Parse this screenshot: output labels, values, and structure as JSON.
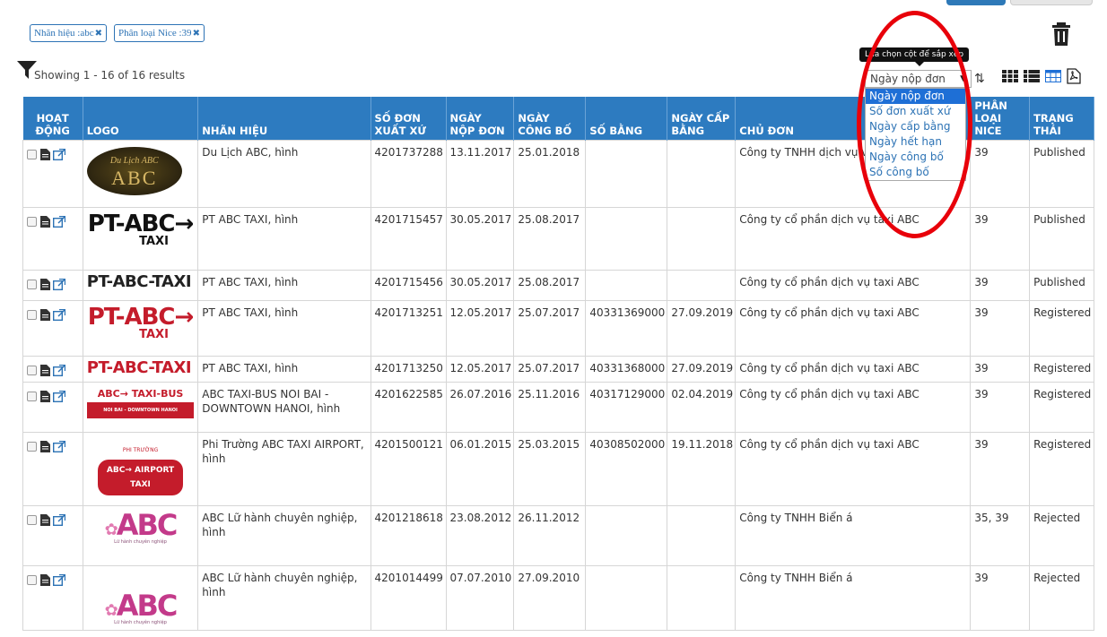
{
  "filters": {
    "tags": [
      {
        "label": "Nhãn hiệu :abc"
      },
      {
        "label": "Phân loại Nice :39"
      }
    ],
    "remove_glyph": "✖"
  },
  "results_text": "Showing 1 - 16 of 16 results",
  "sort": {
    "tooltip": "Lựa chọn cột để sắp xếp",
    "selected": "Ngày nộp đơn",
    "options": [
      "Ngày nộp đơn",
      "Số đơn xuất xứ",
      "Ngày cấp bằng",
      "Ngày hết hạn",
      "Ngày công bố",
      "Số công bố"
    ]
  },
  "icons": {
    "trash": "trash-icon",
    "filter": "filter-icon",
    "grid": "grid-view-icon",
    "list": "list-view-icon",
    "table": "table-view-icon",
    "pdf": "pdf-icon",
    "sort_direction": "sort-direction-icon"
  },
  "table": {
    "headers": {
      "action": "HOẠT ĐỘNG",
      "logo": "LOGO",
      "mark": "NHÃN HIỆU",
      "app_no": "SỐ ĐƠN XUẤT XỨ",
      "filing_date": "NGÀY NỘP ĐƠN",
      "pub_date": "NGÀY CÔNG BỐ",
      "reg_no": "SỐ BẰNG",
      "grant_date": "NGÀY CẤP BẰNG",
      "owner": "CHỦ ĐƠN",
      "nice": "PHÂN LOẠI NICE",
      "status": "TRẠNG THÁI"
    },
    "rows": [
      {
        "logo_text": "Du Lịch ABC",
        "mark": "Du Lịch ABC, hình",
        "app_no": "4201737288",
        "filing_date": "13.11.2017",
        "pub_date": "25.01.2018",
        "reg_no": "",
        "grant_date": "",
        "owner": "Công ty TNHH dịch vụ và",
        "nice": "39",
        "status": "Published"
      },
      {
        "logo_text": "PT ABC TAXI",
        "mark": "PT ABC TAXI, hình",
        "app_no": "4201715457",
        "filing_date": "30.05.2017",
        "pub_date": "25.08.2017",
        "reg_no": "",
        "grant_date": "",
        "owner": "Công ty cổ phần dịch vụ taxi ABC",
        "nice": "39",
        "status": "Published"
      },
      {
        "logo_text": "PT ABC TAXI",
        "mark": "PT ABC TAXI, hình",
        "app_no": "4201715456",
        "filing_date": "30.05.2017",
        "pub_date": "25.08.2017",
        "reg_no": "",
        "grant_date": "",
        "owner": "Công ty cổ phần dịch vụ taxi ABC",
        "nice": "39",
        "status": "Published"
      },
      {
        "logo_text": "PT ABC TAXI",
        "mark": "PT ABC TAXI, hình",
        "app_no": "4201713251",
        "filing_date": "12.05.2017",
        "pub_date": "25.07.2017",
        "reg_no": "40331369000",
        "grant_date": "27.09.2019",
        "owner": "Công ty cổ phần dịch vụ taxi ABC",
        "nice": "39",
        "status": "Registered"
      },
      {
        "logo_text": "PT ABC TAXI",
        "mark": "PT ABC TAXI, hình",
        "app_no": "4201713250",
        "filing_date": "12.05.2017",
        "pub_date": "25.07.2017",
        "reg_no": "40331368000",
        "grant_date": "27.09.2019",
        "owner": "Công ty cổ phần dịch vụ taxi ABC",
        "nice": "39",
        "status": "Registered"
      },
      {
        "logo_text": "ABC TAXI-BUS",
        "mark": "ABC TAXI-BUS NOI BAI - DOWNTOWN HANOI, hình",
        "app_no": "4201622585",
        "filing_date": "26.07.2016",
        "pub_date": "25.11.2016",
        "reg_no": "40317129000",
        "grant_date": "02.04.2019",
        "owner": "Công ty cổ phần dịch vụ taxi ABC",
        "nice": "39",
        "status": "Registered"
      },
      {
        "logo_text": "ABC AIRPORT TAXI",
        "mark": "Phi Trường ABC TAXI AIRPORT, hình",
        "app_no": "4201500121",
        "filing_date": "06.01.2015",
        "pub_date": "25.03.2015",
        "reg_no": "40308502000",
        "grant_date": "19.11.2018",
        "owner": "Công ty cổ phần dịch vụ taxi ABC",
        "nice": "39",
        "status": "Registered"
      },
      {
        "logo_text": "ABC",
        "mark": "ABC Lữ hành chuyên nghiệp, hình",
        "app_no": "4201218618",
        "filing_date": "23.08.2012",
        "pub_date": "26.11.2012",
        "reg_no": "",
        "grant_date": "",
        "owner": "Công ty TNHH Biển á",
        "nice": "35, 39",
        "status": "Rejected"
      },
      {
        "logo_text": "ABC",
        "mark": "ABC Lữ hành chuyên nghiệp, hình",
        "app_no": "4201014499",
        "filing_date": "07.07.2010",
        "pub_date": "27.09.2010",
        "reg_no": "",
        "grant_date": "",
        "owner": "Công ty TNHH Biển á",
        "nice": "39",
        "status": "Rejected"
      }
    ]
  },
  "colors": {
    "header_bg": "#2d7bc0",
    "highlight_oval": "#e8000a",
    "link": "#2d73b5"
  }
}
